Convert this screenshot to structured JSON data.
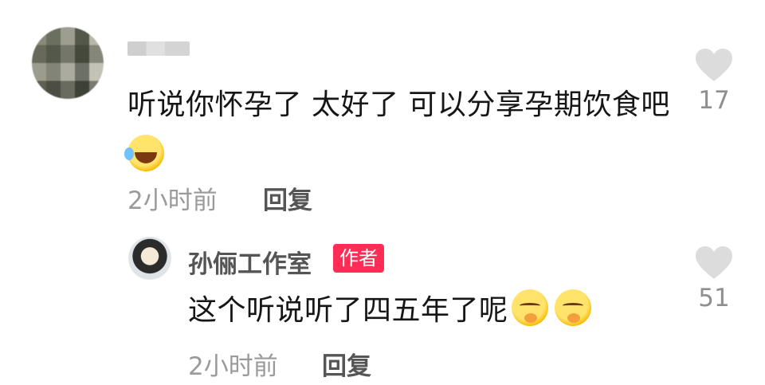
{
  "comment": {
    "username": "",
    "text": "听说你怀孕了 太好了 可以分享孕期饮食吧",
    "emoji": "laughing-crying-emoji",
    "time": "2小时前",
    "reply_label": "回复",
    "likes": "17"
  },
  "reply": {
    "username": "孙俪工作室",
    "badge": "作者",
    "text": "这个听说听了四五年了呢",
    "emojis": [
      "relieved-face-emoji",
      "relieved-face-emoji"
    ],
    "time": "2小时前",
    "reply_label": "回复",
    "likes": "51"
  },
  "colors": {
    "badge": "#ff2c55",
    "meta": "#9a9a9a",
    "heart": "#dcdcdc"
  }
}
